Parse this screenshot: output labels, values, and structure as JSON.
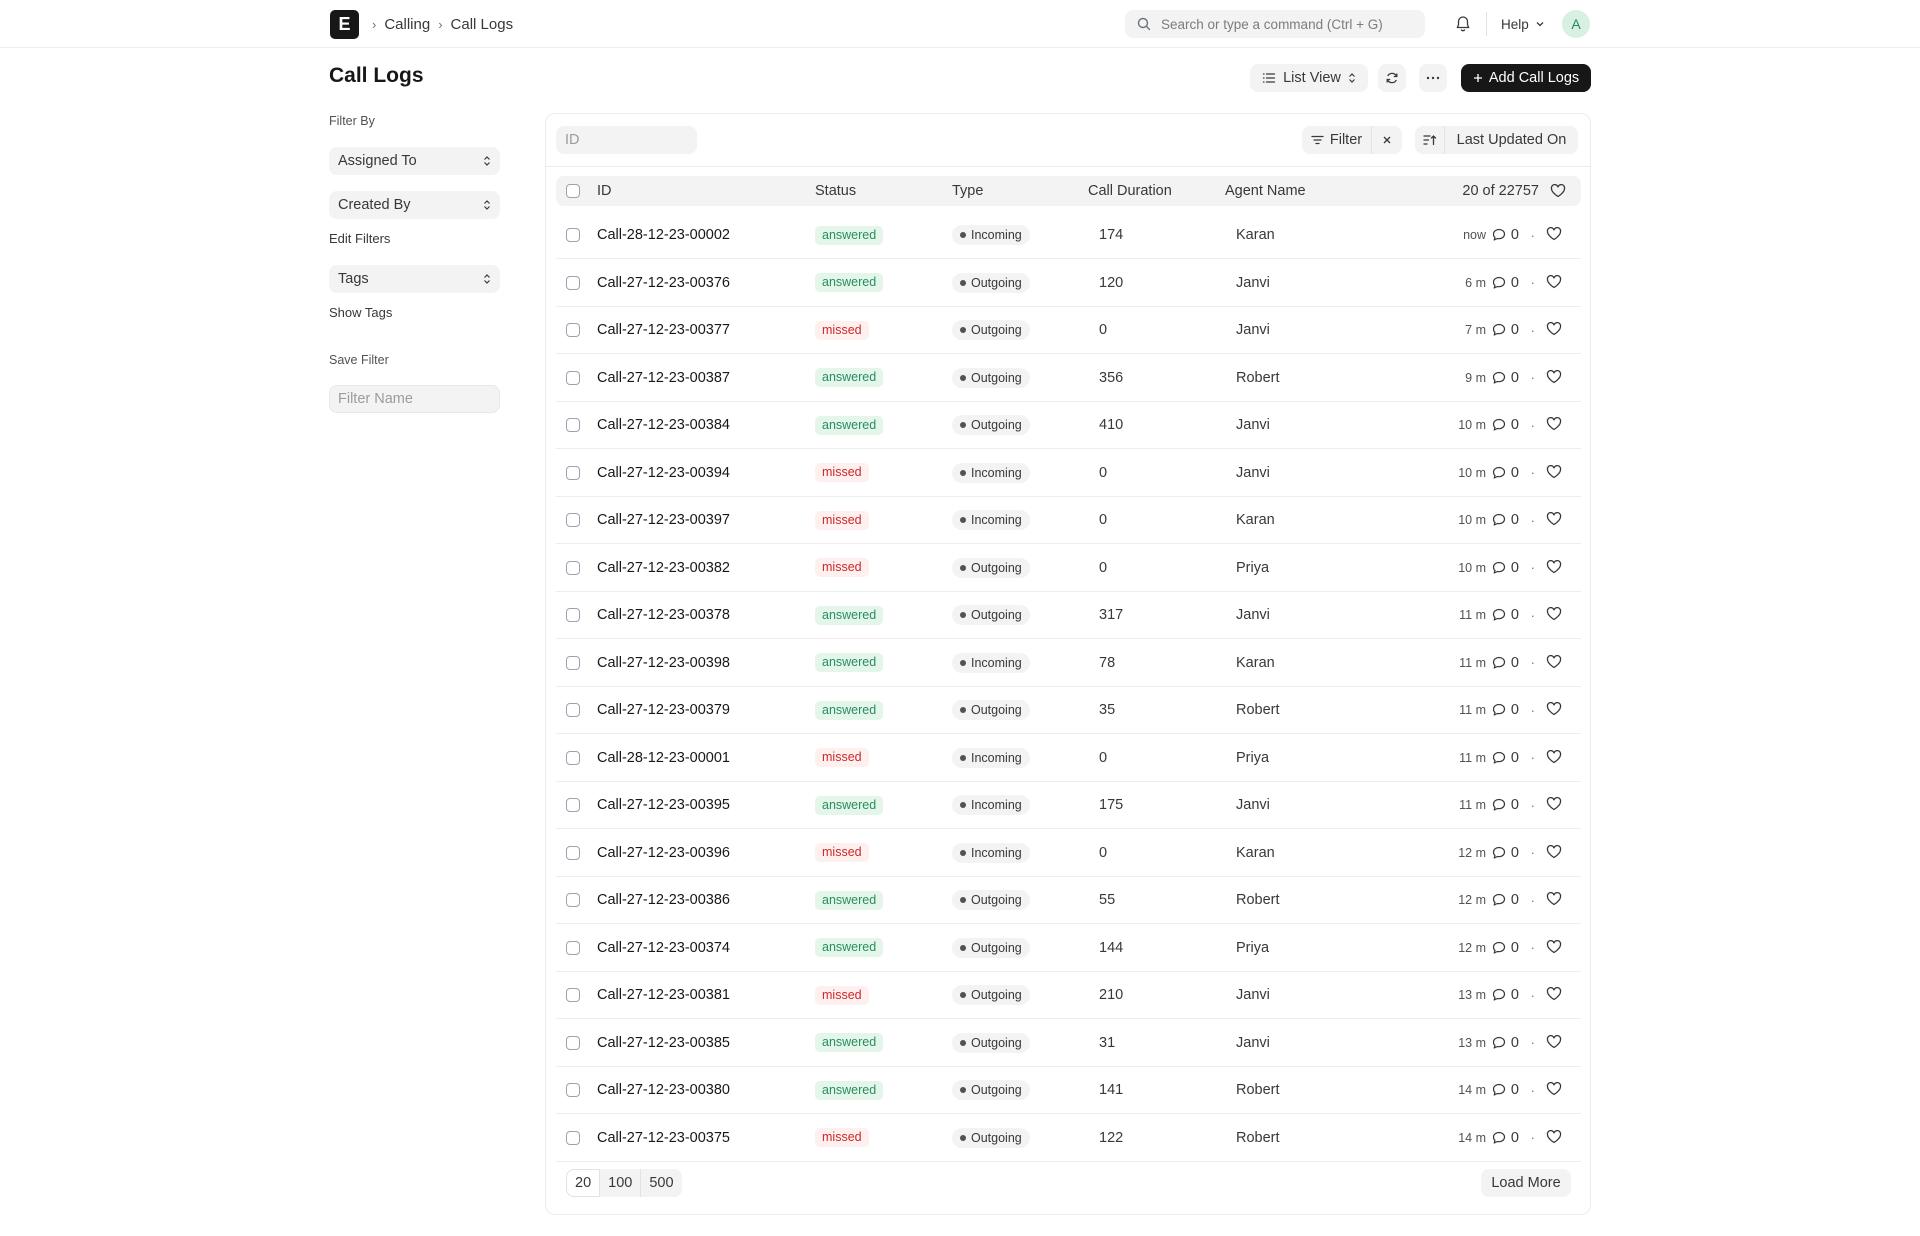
{
  "navbar": {
    "logo_letter": "E",
    "breadcrumbs": [
      "Calling",
      "Call Logs"
    ],
    "search_placeholder": "Search or type a command (Ctrl + G)",
    "help_label": "Help",
    "avatar_initial": "A"
  },
  "page": {
    "title": "Call Logs",
    "list_view_label": "List View",
    "add_button_label": "Add Call Logs"
  },
  "sidebar": {
    "filter_by_label": "Filter By",
    "assigned_to": "Assigned To",
    "created_by": "Created By",
    "edit_filters": "Edit Filters",
    "tags": "Tags",
    "show_tags": "Show Tags",
    "save_filter_label": "Save Filter",
    "filter_name_placeholder": "Filter Name"
  },
  "toolbar": {
    "id_placeholder": "ID",
    "filter_label": "Filter",
    "sort_label": "Last Updated On"
  },
  "table": {
    "columns": [
      "ID",
      "Status",
      "Type",
      "Call Duration",
      "Agent Name"
    ],
    "count_label": "20 of 22757",
    "rows": [
      {
        "id": "Call-28-12-23-00002",
        "status": "answered",
        "type": "Incoming",
        "duration": "174",
        "agent": "Karan",
        "ago": "now",
        "comments": "0"
      },
      {
        "id": "Call-27-12-23-00376",
        "status": "answered",
        "type": "Outgoing",
        "duration": "120",
        "agent": "Janvi",
        "ago": "6 m",
        "comments": "0"
      },
      {
        "id": "Call-27-12-23-00377",
        "status": "missed",
        "type": "Outgoing",
        "duration": "0",
        "agent": "Janvi",
        "ago": "7 m",
        "comments": "0"
      },
      {
        "id": "Call-27-12-23-00387",
        "status": "answered",
        "type": "Outgoing",
        "duration": "356",
        "agent": "Robert",
        "ago": "9 m",
        "comments": "0"
      },
      {
        "id": "Call-27-12-23-00384",
        "status": "answered",
        "type": "Outgoing",
        "duration": "410",
        "agent": "Janvi",
        "ago": "10 m",
        "comments": "0"
      },
      {
        "id": "Call-27-12-23-00394",
        "status": "missed",
        "type": "Incoming",
        "duration": "0",
        "agent": "Janvi",
        "ago": "10 m",
        "comments": "0"
      },
      {
        "id": "Call-27-12-23-00397",
        "status": "missed",
        "type": "Incoming",
        "duration": "0",
        "agent": "Karan",
        "ago": "10 m",
        "comments": "0"
      },
      {
        "id": "Call-27-12-23-00382",
        "status": "missed",
        "type": "Outgoing",
        "duration": "0",
        "agent": "Priya",
        "ago": "10 m",
        "comments": "0"
      },
      {
        "id": "Call-27-12-23-00378",
        "status": "answered",
        "type": "Outgoing",
        "duration": "317",
        "agent": "Janvi",
        "ago": "11 m",
        "comments": "0"
      },
      {
        "id": "Call-27-12-23-00398",
        "status": "answered",
        "type": "Incoming",
        "duration": "78",
        "agent": "Karan",
        "ago": "11 m",
        "comments": "0"
      },
      {
        "id": "Call-27-12-23-00379",
        "status": "answered",
        "type": "Outgoing",
        "duration": "35",
        "agent": "Robert",
        "ago": "11 m",
        "comments": "0"
      },
      {
        "id": "Call-28-12-23-00001",
        "status": "missed",
        "type": "Incoming",
        "duration": "0",
        "agent": "Priya",
        "ago": "11 m",
        "comments": "0"
      },
      {
        "id": "Call-27-12-23-00395",
        "status": "answered",
        "type": "Incoming",
        "duration": "175",
        "agent": "Janvi",
        "ago": "11 m",
        "comments": "0"
      },
      {
        "id": "Call-27-12-23-00396",
        "status": "missed",
        "type": "Incoming",
        "duration": "0",
        "agent": "Karan",
        "ago": "12 m",
        "comments": "0"
      },
      {
        "id": "Call-27-12-23-00386",
        "status": "answered",
        "type": "Outgoing",
        "duration": "55",
        "agent": "Robert",
        "ago": "12 m",
        "comments": "0"
      },
      {
        "id": "Call-27-12-23-00374",
        "status": "answered",
        "type": "Outgoing",
        "duration": "144",
        "agent": "Priya",
        "ago": "12 m",
        "comments": "0"
      },
      {
        "id": "Call-27-12-23-00381",
        "status": "missed",
        "type": "Outgoing",
        "duration": "210",
        "agent": "Janvi",
        "ago": "13 m",
        "comments": "0"
      },
      {
        "id": "Call-27-12-23-00385",
        "status": "answered",
        "type": "Outgoing",
        "duration": "31",
        "agent": "Janvi",
        "ago": "13 m",
        "comments": "0"
      },
      {
        "id": "Call-27-12-23-00380",
        "status": "answered",
        "type": "Outgoing",
        "duration": "141",
        "agent": "Robert",
        "ago": "14 m",
        "comments": "0"
      },
      {
        "id": "Call-27-12-23-00375",
        "status": "missed",
        "type": "Outgoing",
        "duration": "122",
        "agent": "Robert",
        "ago": "14 m",
        "comments": "0"
      }
    ]
  },
  "pagination": {
    "sizes": [
      "20",
      "100",
      "500"
    ],
    "load_more": "Load More"
  },
  "colors": {
    "answered_bg": "#e4f5e9",
    "answered_text": "#278f5e",
    "missed_bg": "#fff0f0",
    "missed_text": "#cc2929",
    "primary_button": "#171717"
  }
}
